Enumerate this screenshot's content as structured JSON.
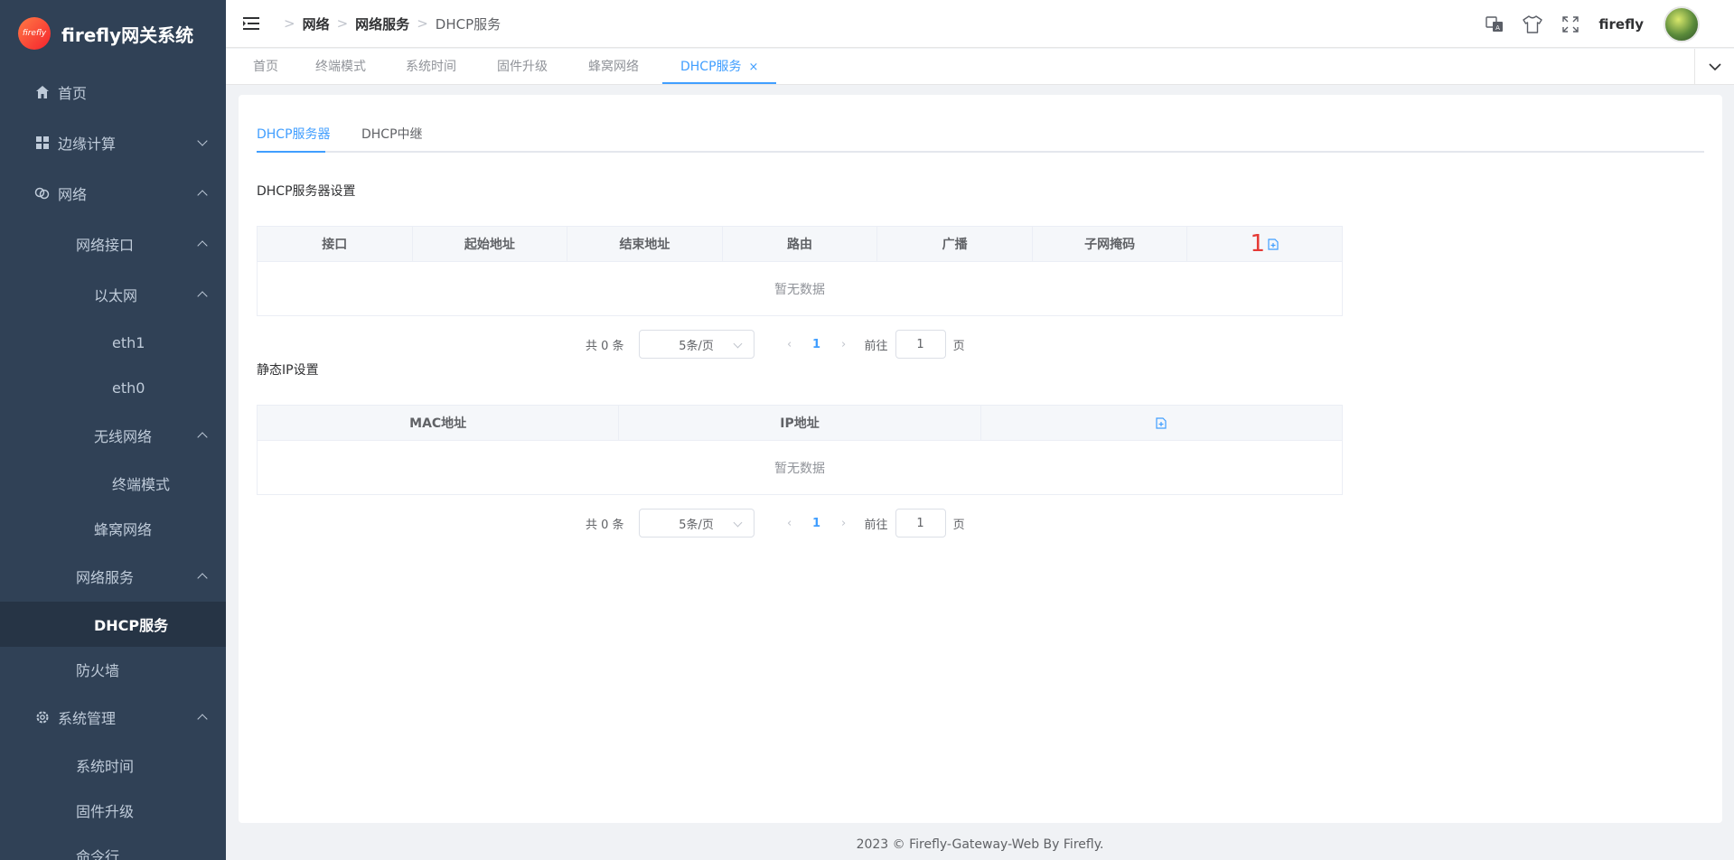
{
  "app": {
    "title": "firefly网关系统",
    "logo_text": "firefly"
  },
  "sidebar": {
    "home": "首页",
    "edge": "边缘计算",
    "network": "网络",
    "net_iface": "网络接口",
    "ethernet": "以太网",
    "eth1": "eth1",
    "eth0": "eth0",
    "wireless": "无线网络",
    "terminal": "终端模式",
    "cellular": "蜂窝网络",
    "net_service": "网络服务",
    "dhcp": "DHCP服务",
    "firewall": "防火墙",
    "sys_mgmt": "系统管理",
    "sys_time": "系统时间",
    "firmware": "固件升级",
    "cmdline": "命令行"
  },
  "header": {
    "breadcrumb": [
      "网络",
      "网络服务",
      "DHCP服务"
    ],
    "username": "firefly",
    "icons": [
      "translate-icon",
      "shirt-icon",
      "fullscreen-icon"
    ]
  },
  "tags": [
    "首页",
    "终端模式",
    "系统时间",
    "固件升级",
    "蜂窝网络",
    "DHCP服务"
  ],
  "tabs": {
    "server": "DHCP服务器",
    "relay": "DHCP中继"
  },
  "dhcp_section": {
    "title": "DHCP服务器设置",
    "columns": [
      "接口",
      "起始地址",
      "结束地址",
      "路由",
      "广播",
      "子网掩码"
    ],
    "marker": "1",
    "empty": "暂无数据"
  },
  "static_section": {
    "title": "静态IP设置",
    "columns": [
      "MAC地址",
      "IP地址"
    ],
    "empty": "暂无数据"
  },
  "pagination": {
    "total": "共 0 条",
    "page_size": "5条/页",
    "page": "1",
    "goto": "前往",
    "jump_value": "1",
    "page_suffix": "页"
  },
  "footer": "2023 © Firefly-Gateway-Web By Firefly.",
  "colors": {
    "sidebar_bg": "#304156",
    "accent": "#409eff",
    "marker": "#e53935"
  }
}
